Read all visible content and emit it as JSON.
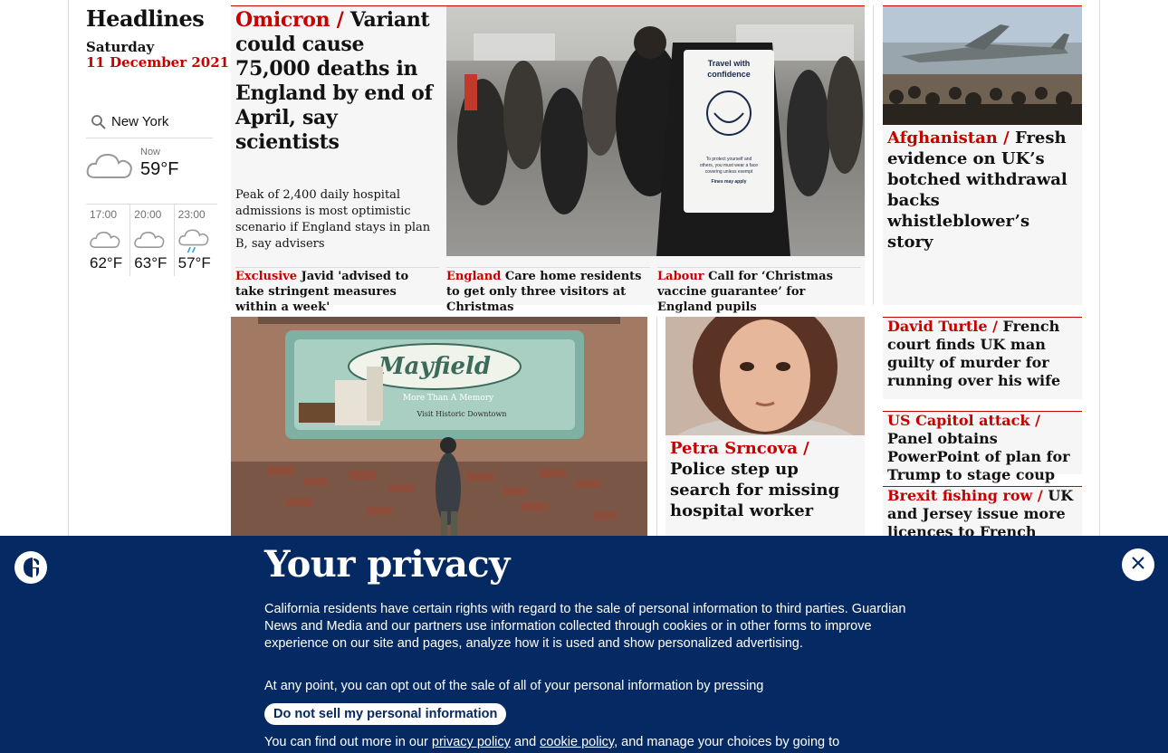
{
  "rail": {
    "heading": "Headlines",
    "day": "Saturday",
    "date": "11 December 2021"
  },
  "weather": {
    "location": "New York",
    "now_label": "Now",
    "now_temp": "59°F",
    "forecast": [
      {
        "time": "17:00",
        "temp": "62°F",
        "icon": "cloud-icon"
      },
      {
        "time": "20:00",
        "temp": "63°F",
        "icon": "cloud-icon"
      },
      {
        "time": "23:00",
        "temp": "57°F",
        "icon": "rain-cloud-icon"
      }
    ]
  },
  "lead": {
    "kicker": "Omicron /",
    "headline": "Variant could cause 75,000 deaths in England by end of April, say scientists",
    "standfirst": "Peak of 2,400 daily hospital admissions is most optimistic scenario if England stays in plan B, say advisers",
    "image_sign": [
      "Travel with",
      "confidence",
      "To protect yourself and",
      "others, you must wear a face",
      "covering unless exempt",
      "Fines may apply"
    ],
    "sublinks": [
      {
        "kicker": "Exclusive",
        "text": "Javid 'advised to take stringent measures within a week'"
      },
      {
        "kicker": "England",
        "text": "Care home residents to get only three visitors at Christmas"
      },
      {
        "kicker": "Labour",
        "text": "Call for ‘Christmas vaccine guarantee’ for England pupils"
      }
    ]
  },
  "afghanistan": {
    "kicker": "Afghanistan /",
    "headline": "Fresh evidence on UK’s botched withdrawal backs whistleblower’s story"
  },
  "mayfield": {
    "mural_title": "Mayfield",
    "mural_sub": "More Than A Memory",
    "mural_sub2": "Visit Historic Downtown"
  },
  "petra": {
    "kicker": "Petra Srncova /",
    "headline": "Police step up search for missing hospital worker"
  },
  "side_stories": [
    {
      "kicker": "David Turtle /",
      "headline": "French court finds UK man guilty of murder for running over his wife"
    },
    {
      "kicker": "US Capitol attack /",
      "headline": "Panel obtains PowerPoint of plan for Trump to stage coup"
    },
    {
      "kicker": "Brexit fishing row /",
      "headline": "UK and Jersey issue more licences to French boats"
    }
  ],
  "consent": {
    "title": "Your privacy",
    "body": "California residents have certain rights with regard to the sale of personal information to third parties. Guardian News and Media and our partners use information collected through cookies or in other forms to improve experience on our site and pages, analyze how it is used and show personalized advertising.",
    "optout": "At any point, you can opt out of the sale of all of your personal information by pressing",
    "button": "Do not sell my personal information",
    "more_prefix": "You can find out more in our",
    "privacy_link": "privacy policy",
    "and": "and",
    "cookie_link": "cookie policy",
    "more_suffix": ", and manage your choices by going to"
  },
  "colors": {
    "accent": "#c70000",
    "banner": "#052962",
    "card": "#f6f6f6"
  }
}
